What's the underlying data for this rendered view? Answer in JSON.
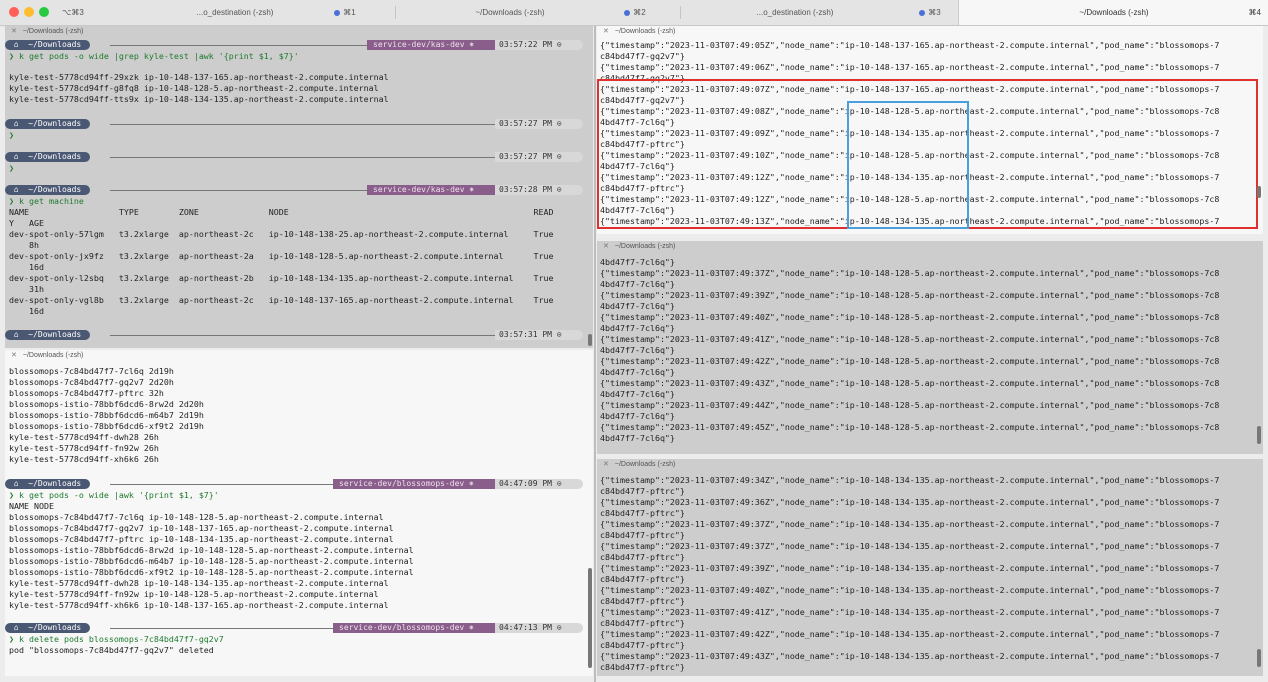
{
  "titlebar": {
    "tabs": [
      {
        "label": "⌥⌘3"
      },
      {
        "label": "...o_destination (-zsh)"
      },
      {
        "label": "⌘1"
      },
      {
        "label": "~/Downloads (-zsh)"
      },
      {
        "label": "⌘2"
      },
      {
        "label": "...o_destination (-zsh)"
      },
      {
        "label": "⌘3"
      },
      {
        "label": "~/Downloads (-zsh)"
      },
      {
        "label": "⌘4"
      }
    ]
  },
  "pane1": {
    "title": "~/Downloads (-zsh)",
    "prompt_dir": " ⌂  ~/Downloads ",
    "ctx": "service-dev/kas-dev ⎈",
    "times": [
      "03:57:22 PM ⊙",
      "03:57:27 PM ⊙",
      "03:57:27 PM ⊙",
      "03:57:28 PM ⊙",
      "03:57:31 PM ⊙"
    ],
    "cmd1": "❯ k get pods -o wide |grep kyle-test |awk '{print $1, $7}'",
    "out1": [
      "kyle-test-5778cd94ff-29xzk ip-10-148-137-165.ap-northeast-2.compute.internal",
      "kyle-test-5778cd94ff-g8fq8 ip-10-148-128-5.ap-northeast-2.compute.internal",
      "kyle-test-5778cd94ff-tts9x ip-10-148-134-135.ap-northeast-2.compute.internal"
    ],
    "empty_prompt": "❯",
    "cmd2": "❯ k get machine",
    "table": [
      "NAME                  TYPE        ZONE              NODE                                                 READ",
      "Y   AGE",
      "dev-spot-only-57lgm   t3.2xlarge  ap-northeast-2c   ip-10-148-138-25.ap-northeast-2.compute.internal     True",
      "    8h",
      "dev-spot-only-jx9fz   t3.2xlarge  ap-northeast-2a   ip-10-148-128-5.ap-northeast-2.compute.internal      True",
      "    16d",
      "dev-spot-only-l2sbq   t3.2xlarge  ap-northeast-2b   ip-10-148-134-135.ap-northeast-2.compute.internal    True",
      "    31h",
      "dev-spot-only-vgl8b   t3.2xlarge  ap-northeast-2c   ip-10-148-137-165.ap-northeast-2.compute.internal    True",
      "    16d"
    ]
  },
  "pane2": {
    "title": "~/Downloads (-zsh)",
    "prompt_dir": " ⌂  ~/Downloads ",
    "ctx": "service-dev/blossomops-dev ⎈",
    "times": [
      "04:47:09 PM ⊙",
      "04:47:13 PM ⊙"
    ],
    "out0": [
      "blossomops-7c84bd47f7-7cl6q 2d19h",
      "blossomops-7c84bd47f7-gq2v7 2d20h",
      "blossomops-7c84bd47f7-pftrc 32h",
      "blossomops-istio-78bbf6dcd6-8rw2d 2d20h",
      "blossomops-istio-78bbf6dcd6-m64b7 2d19h",
      "blossomops-istio-78bbf6dcd6-xf9t2 2d19h",
      "kyle-test-5778cd94ff-dwh28 26h",
      "kyle-test-5778cd94ff-fn92w 26h",
      "kyle-test-5778cd94ff-xh6k6 26h"
    ],
    "cmd1": "❯ k get pods -o wide |awk '{print $1, $7}'",
    "out1": [
      "NAME NODE",
      "blossomops-7c84bd47f7-7cl6q ip-10-148-128-5.ap-northeast-2.compute.internal",
      "blossomops-7c84bd47f7-gq2v7 ip-10-148-137-165.ap-northeast-2.compute.internal",
      "blossomops-7c84bd47f7-pftrc ip-10-148-134-135.ap-northeast-2.compute.internal",
      "blossomops-istio-78bbf6dcd6-8rw2d ip-10-148-128-5.ap-northeast-2.compute.internal",
      "blossomops-istio-78bbf6dcd6-m64b7 ip-10-148-128-5.ap-northeast-2.compute.internal",
      "blossomops-istio-78bbf6dcd6-xf9t2 ip-10-148-128-5.ap-northeast-2.compute.internal",
      "kyle-test-5778cd94ff-dwh28 ip-10-148-134-135.ap-northeast-2.compute.internal",
      "kyle-test-5778cd94ff-fn92w ip-10-148-128-5.ap-northeast-2.compute.internal",
      "kyle-test-5778cd94ff-xh6k6 ip-10-148-137-165.ap-northeast-2.compute.internal"
    ],
    "cmd2": "❯ k delete pods blossomops-7c84bd47f7-gq2v7",
    "out2": "pod \"blossomops-7c84bd47f7-gq2v7\" deleted"
  },
  "pane3": {
    "title": "~/Downloads (-zsh)",
    "lines": [
      "{\"timestamp\":\"2023-11-03T07:49:05Z\",\"node_name\":\"ip-10-148-137-165.ap-northeast-2.compute.internal\",\"pod_name\":\"blossomops-7",
      "c84bd47f7-gq2v7\"}",
      "{\"timestamp\":\"2023-11-03T07:49:06Z\",\"node_name\":\"ip-10-148-137-165.ap-northeast-2.compute.internal\",\"pod_name\":\"blossomops-7",
      "c84bd47f7-gq2v7\"}",
      "{\"timestamp\":\"2023-11-03T07:49:07Z\",\"node_name\":\"ip-10-148-137-165.ap-northeast-2.compute.internal\",\"pod_name\":\"blossomops-7",
      "c84bd47f7-gq2v7\"}",
      "{\"timestamp\":\"2023-11-03T07:49:08Z\",\"node_name\":\"ip-10-148-128-5.ap-northeast-2.compute.internal\",\"pod_name\":\"blossomops-7c8",
      "4bd47f7-7cl6q\"}",
      "{\"timestamp\":\"2023-11-03T07:49:09Z\",\"node_name\":\"ip-10-148-134-135.ap-northeast-2.compute.internal\",\"pod_name\":\"blossomops-7",
      "c84bd47f7-pftrc\"}",
      "{\"timestamp\":\"2023-11-03T07:49:10Z\",\"node_name\":\"ip-10-148-128-5.ap-northeast-2.compute.internal\",\"pod_name\":\"blossomops-7c8",
      "4bd47f7-7cl6q\"}",
      "{\"timestamp\":\"2023-11-03T07:49:12Z\",\"node_name\":\"ip-10-148-134-135.ap-northeast-2.compute.internal\",\"pod_name\":\"blossomops-7",
      "c84bd47f7-pftrc\"}",
      "{\"timestamp\":\"2023-11-03T07:49:12Z\",\"node_name\":\"ip-10-148-128-5.ap-northeast-2.compute.internal\",\"pod_name\":\"blossomops-7c8",
      "4bd47f7-7cl6q\"}",
      "{\"timestamp\":\"2023-11-03T07:49:13Z\",\"node_name\":\"ip-10-148-134-135.ap-northeast-2.compute.internal\",\"pod_name\":\"blossomops-7"
    ]
  },
  "pane4": {
    "title": "~/Downloads (-zsh)",
    "lines": [
      "4bd47f7-7cl6q\"}",
      "{\"timestamp\":\"2023-11-03T07:49:37Z\",\"node_name\":\"ip-10-148-128-5.ap-northeast-2.compute.internal\",\"pod_name\":\"blossomops-7c8",
      "4bd47f7-7cl6q\"}",
      "{\"timestamp\":\"2023-11-03T07:49:39Z\",\"node_name\":\"ip-10-148-128-5.ap-northeast-2.compute.internal\",\"pod_name\":\"blossomops-7c8",
      "4bd47f7-7cl6q\"}",
      "{\"timestamp\":\"2023-11-03T07:49:40Z\",\"node_name\":\"ip-10-148-128-5.ap-northeast-2.compute.internal\",\"pod_name\":\"blossomops-7c8",
      "4bd47f7-7cl6q\"}",
      "{\"timestamp\":\"2023-11-03T07:49:41Z\",\"node_name\":\"ip-10-148-128-5.ap-northeast-2.compute.internal\",\"pod_name\":\"blossomops-7c8",
      "4bd47f7-7cl6q\"}",
      "{\"timestamp\":\"2023-11-03T07:49:42Z\",\"node_name\":\"ip-10-148-128-5.ap-northeast-2.compute.internal\",\"pod_name\":\"blossomops-7c8",
      "4bd47f7-7cl6q\"}",
      "{\"timestamp\":\"2023-11-03T07:49:43Z\",\"node_name\":\"ip-10-148-128-5.ap-northeast-2.compute.internal\",\"pod_name\":\"blossomops-7c8",
      "4bd47f7-7cl6q\"}",
      "{\"timestamp\":\"2023-11-03T07:49:44Z\",\"node_name\":\"ip-10-148-128-5.ap-northeast-2.compute.internal\",\"pod_name\":\"blossomops-7c8",
      "4bd47f7-7cl6q\"}",
      "{\"timestamp\":\"2023-11-03T07:49:45Z\",\"node_name\":\"ip-10-148-128-5.ap-northeast-2.compute.internal\",\"pod_name\":\"blossomops-7c8",
      "4bd47f7-7cl6q\"}"
    ]
  },
  "pane5": {
    "title": "~/Downloads (-zsh)",
    "lines": [
      "{\"timestamp\":\"2023-11-03T07:49:34Z\",\"node_name\":\"ip-10-148-134-135.ap-northeast-2.compute.internal\",\"pod_name\":\"blossomops-7",
      "c84bd47f7-pftrc\"}",
      "{\"timestamp\":\"2023-11-03T07:49:36Z\",\"node_name\":\"ip-10-148-134-135.ap-northeast-2.compute.internal\",\"pod_name\":\"blossomops-7",
      "c84bd47f7-pftrc\"}",
      "{\"timestamp\":\"2023-11-03T07:49:37Z\",\"node_name\":\"ip-10-148-134-135.ap-northeast-2.compute.internal\",\"pod_name\":\"blossomops-7",
      "c84bd47f7-pftrc\"}",
      "{\"timestamp\":\"2023-11-03T07:49:37Z\",\"node_name\":\"ip-10-148-134-135.ap-northeast-2.compute.internal\",\"pod_name\":\"blossomops-7",
      "c84bd47f7-pftrc\"}",
      "{\"timestamp\":\"2023-11-03T07:49:39Z\",\"node_name\":\"ip-10-148-134-135.ap-northeast-2.compute.internal\",\"pod_name\":\"blossomops-7",
      "c84bd47f7-pftrc\"}",
      "{\"timestamp\":\"2023-11-03T07:49:40Z\",\"node_name\":\"ip-10-148-134-135.ap-northeast-2.compute.internal\",\"pod_name\":\"blossomops-7",
      "c84bd47f7-pftrc\"}",
      "{\"timestamp\":\"2023-11-03T07:49:41Z\",\"node_name\":\"ip-10-148-134-135.ap-northeast-2.compute.internal\",\"pod_name\":\"blossomops-7",
      "c84bd47f7-pftrc\"}",
      "{\"timestamp\":\"2023-11-03T07:49:42Z\",\"node_name\":\"ip-10-148-134-135.ap-northeast-2.compute.internal\",\"pod_name\":\"blossomops-7",
      "c84bd47f7-pftrc\"}",
      "{\"timestamp\":\"2023-11-03T07:49:43Z\",\"node_name\":\"ip-10-148-134-135.ap-northeast-2.compute.internal\",\"pod_name\":\"blossomops-7",
      "c84bd47f7-pftrc\"}"
    ]
  },
  "colors": {
    "red_highlight": "#e03030",
    "blue_highlight": "#4aa0dc",
    "prompt_bg": "#4a5873",
    "ctx_bg": "#8a5e8b"
  }
}
